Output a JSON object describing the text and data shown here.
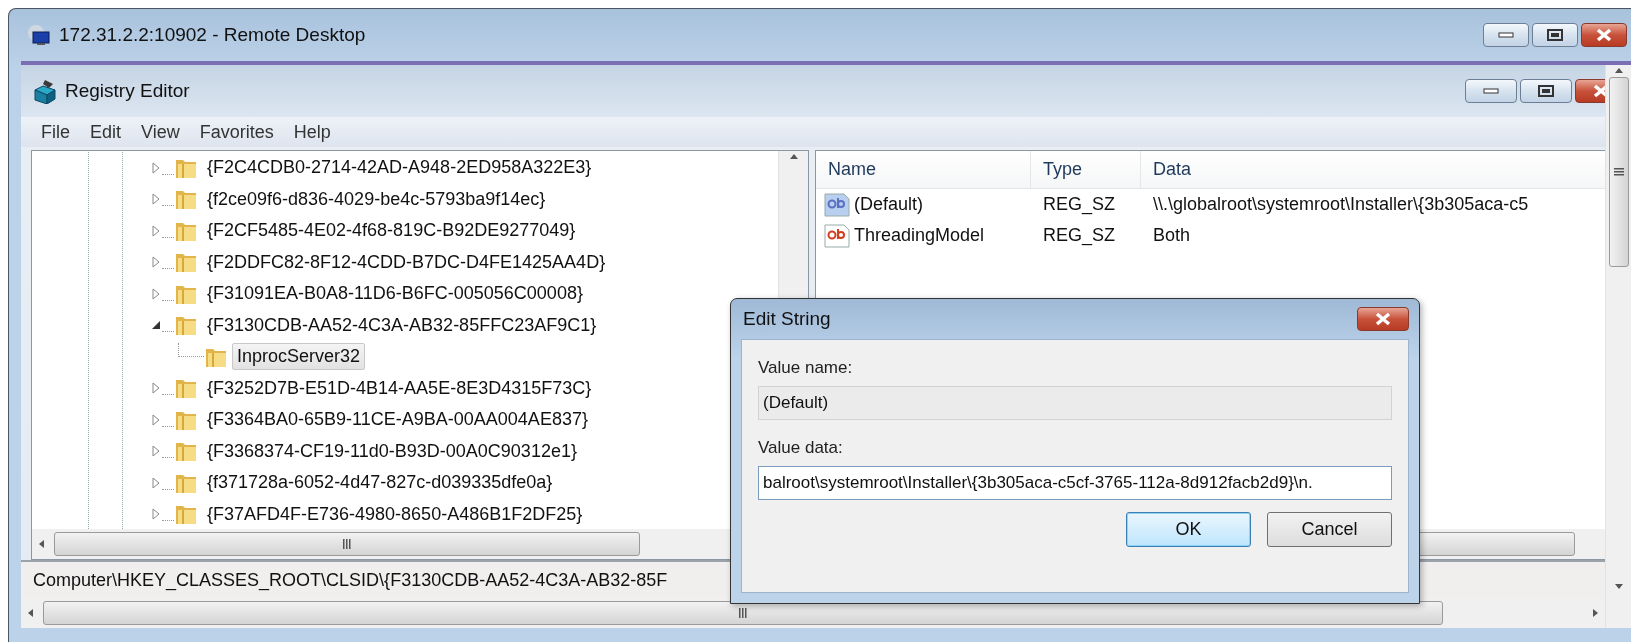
{
  "remote_window": {
    "title": "172.31.2.2:10902 - Remote Desktop"
  },
  "registry_window": {
    "title": "Registry Editor"
  },
  "menu": [
    "File",
    "Edit",
    "View",
    "Favorites",
    "Help"
  ],
  "tree": [
    {
      "label": "{F2C4CDB0-2714-42AD-A948-2ED958A322E3}",
      "expandable": true,
      "expanded": false,
      "selected": false
    },
    {
      "label": "{f2ce09f6-d836-4029-be4c-5793ba9f14ec}",
      "expandable": true,
      "expanded": false,
      "selected": false
    },
    {
      "label": "{F2CF5485-4E02-4f68-819C-B92DE9277049}",
      "expandable": true,
      "expanded": false,
      "selected": false
    },
    {
      "label": "{F2DDFC82-8F12-4CDD-B7DC-D4FE1425AA4D}",
      "expandable": true,
      "expanded": false,
      "selected": false
    },
    {
      "label": "{F31091EA-B0A8-11D6-B6FC-005056C00008}",
      "expandable": true,
      "expanded": false,
      "selected": false
    },
    {
      "label": "{F3130CDB-AA52-4C3A-AB32-85FFC23AF9C1}",
      "expandable": true,
      "expanded": true,
      "selected": false,
      "children": [
        {
          "label": "InprocServer32",
          "expandable": false,
          "expanded": false,
          "selected": true
        }
      ]
    },
    {
      "label": "{F3252D7B-E51D-4B14-AA5E-8E3D4315F73C}",
      "expandable": true,
      "expanded": false,
      "selected": false
    },
    {
      "label": "{F3364BA0-65B9-11CE-A9BA-00AA004AE837}",
      "expandable": true,
      "expanded": false,
      "selected": false
    },
    {
      "label": "{F3368374-CF19-11d0-B93D-00A0C90312e1}",
      "expandable": true,
      "expanded": false,
      "selected": false
    },
    {
      "label": "{f371728a-6052-4d47-827c-d039335dfe0a}",
      "expandable": true,
      "expanded": false,
      "selected": false
    },
    {
      "label": "{F37AFD4F-E736-4980-8650-A486B1F2DF25}",
      "expandable": true,
      "expanded": false,
      "selected": false
    }
  ],
  "values": {
    "columns": [
      "Name",
      "Type",
      "Data"
    ],
    "rows": [
      {
        "name": "(Default)",
        "type": "REG_SZ",
        "data": "\\\\.\\globalroot\\systemroot\\Installer\\{3b305aca-c5",
        "selected": true
      },
      {
        "name": "ThreadingModel",
        "type": "REG_SZ",
        "data": "Both",
        "selected": false
      }
    ]
  },
  "status_bar": "Computer\\HKEY_CLASSES_ROOT\\CLSID\\{F3130CDB-AA52-4C3A-AB32-85F",
  "dialog": {
    "title": "Edit String",
    "value_name_label": "Value name:",
    "value_name": "(Default)",
    "value_data_label": "Value data:",
    "value_data": "balroot\\systemroot\\Installer\\{3b305aca-c5cf-3765-112a-8d912facb2d9}\\n.",
    "buttons": [
      {
        "label": "OK",
        "default": true
      },
      {
        "label": "Cancel",
        "default": false
      }
    ]
  }
}
